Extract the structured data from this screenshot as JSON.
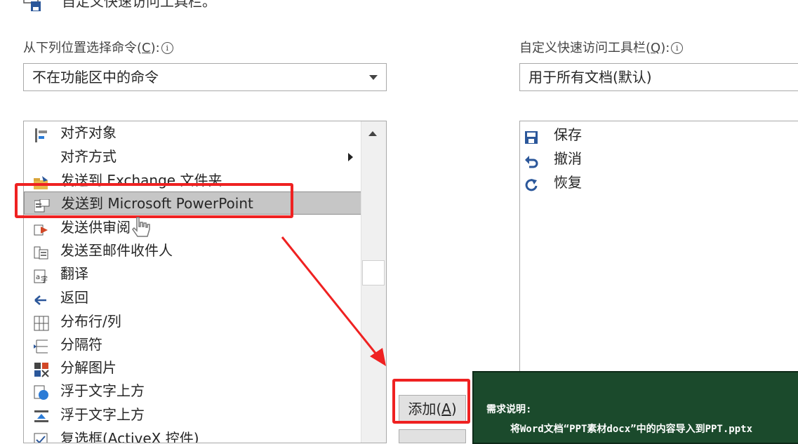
{
  "header": {
    "title_fragment": "自定义快速访问工具栏。"
  },
  "left": {
    "label_prefix": "从下列位置选择命令(",
    "label_key": "C",
    "label_suffix": "):",
    "info_glyph": "i",
    "combo_value": "不在功能区中的命令",
    "items": [
      {
        "label": "对齐对象",
        "icon": "align-objects-icon"
      },
      {
        "label": "对齐方式",
        "icon": "none",
        "submenu": true
      },
      {
        "label": "发送到 Exchange 文件夹",
        "icon": "exchange-folder-icon"
      },
      {
        "label": "发送到 Microsoft PowerPoint",
        "icon": "powerpoint-send-icon",
        "selected": true
      },
      {
        "label": "发送供审阅",
        "icon": "send-review-icon"
      },
      {
        "label": "发送至邮件收件人",
        "icon": "mail-recipient-icon"
      },
      {
        "label": "翻译",
        "icon": "translate-icon"
      },
      {
        "label": "返回",
        "icon": "back-arrow-icon"
      },
      {
        "label": "分布行/列",
        "icon": "distribute-rows-icon"
      },
      {
        "label": "分隔符",
        "icon": "separator-icon"
      },
      {
        "label": "分解图片",
        "icon": "ungroup-picture-icon"
      },
      {
        "label": "浮于文字上方",
        "icon": "float-above-text-icon"
      },
      {
        "label": "浮于文字上方",
        "icon": "float-above-text-2-icon"
      },
      {
        "label": "复选框(ActiveX 控件)",
        "icon": "checkbox-activex-icon"
      }
    ]
  },
  "right": {
    "label_prefix": "自定义快速访问工具栏(",
    "label_key": "Q",
    "label_suffix": "):",
    "info_glyph": "i",
    "combo_value": "用于所有文档(默认)",
    "items": [
      {
        "label": "保存",
        "icon": "save-icon"
      },
      {
        "label": "撤消",
        "icon": "undo-icon"
      },
      {
        "label": "恢复",
        "icon": "redo-icon"
      }
    ]
  },
  "add_button": {
    "prefix": "添加(",
    "key": "A",
    "suffix": ")"
  },
  "tooltip": {
    "heading": "需求说明:",
    "body": "将Word文档“PPT素材docx”中的内容导入到PPT.pptx"
  },
  "colors": {
    "highlight": "#ef2121",
    "tooltip_bg": "#1b4a2c",
    "selection": "#c6c6c6"
  }
}
